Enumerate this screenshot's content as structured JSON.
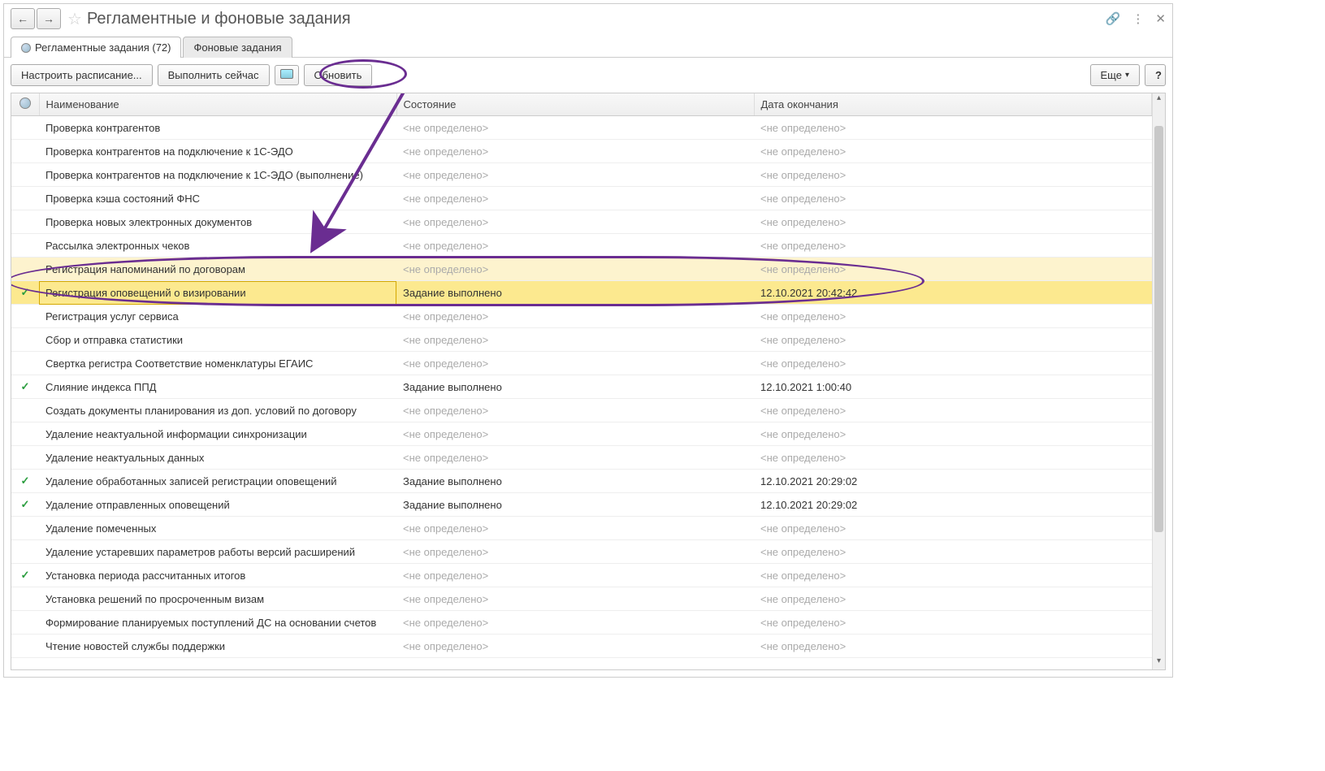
{
  "window": {
    "title": "Регламентные и фоновые задания"
  },
  "tabs": {
    "scheduled": "Регламентные задания (72)",
    "background": "Фоновые задания"
  },
  "toolbar": {
    "configure": "Настроить расписание...",
    "run_now": "Выполнить сейчас",
    "refresh": "Обновить",
    "more": "Еще",
    "help": "?"
  },
  "columns": {
    "name": "Наименование",
    "state": "Состояние",
    "end_date": "Дата окончания"
  },
  "placeholders": {
    "undefined": "<не определено>"
  },
  "states": {
    "done": "Задание выполнено"
  },
  "rows": [
    {
      "check": false,
      "name": "Проверка контрагентов",
      "state": null,
      "date": null,
      "hl": 0
    },
    {
      "check": false,
      "name": "Проверка контрагентов на подключение к 1С-ЭДО",
      "state": null,
      "date": null,
      "hl": 0
    },
    {
      "check": false,
      "name": "Проверка контрагентов на подключение к 1С-ЭДО (выполнение)",
      "state": null,
      "date": null,
      "hl": 0
    },
    {
      "check": false,
      "name": "Проверка кэша состояний ФНС",
      "state": null,
      "date": null,
      "hl": 0
    },
    {
      "check": false,
      "name": "Проверка новых электронных документов",
      "state": null,
      "date": null,
      "hl": 0
    },
    {
      "check": false,
      "name": "Рассылка электронных чеков",
      "state": null,
      "date": null,
      "hl": 0
    },
    {
      "check": false,
      "name": "Регистрация напоминаний по договорам",
      "state": null,
      "date": null,
      "hl": 1
    },
    {
      "check": true,
      "name": "Регистрация оповещений о визировании",
      "state": "done",
      "date": "12.10.2021 20:42:42",
      "hl": 2
    },
    {
      "check": false,
      "name": "Регистрация услуг сервиса",
      "state": null,
      "date": null,
      "hl": 0
    },
    {
      "check": false,
      "name": "Сбор и отправка статистики",
      "state": null,
      "date": null,
      "hl": 0
    },
    {
      "check": false,
      "name": "Свертка регистра Соответствие номенклатуры ЕГАИС",
      "state": null,
      "date": null,
      "hl": 0
    },
    {
      "check": true,
      "name": "Слияние индекса ППД",
      "state": "done",
      "date": "12.10.2021 1:00:40",
      "hl": 0
    },
    {
      "check": false,
      "name": "Создать документы планирования из доп. условий по договору",
      "state": null,
      "date": null,
      "hl": 0
    },
    {
      "check": false,
      "name": "Удаление неактуальной информации синхронизации",
      "state": null,
      "date": null,
      "hl": 0
    },
    {
      "check": false,
      "name": "Удаление неактуальных данных",
      "state": null,
      "date": null,
      "hl": 0
    },
    {
      "check": true,
      "name": "Удаление обработанных записей регистрации оповещений",
      "state": "done",
      "date": "12.10.2021 20:29:02",
      "hl": 0
    },
    {
      "check": true,
      "name": "Удаление отправленных оповещений",
      "state": "done",
      "date": "12.10.2021 20:29:02",
      "hl": 0
    },
    {
      "check": false,
      "name": "Удаление помеченных",
      "state": null,
      "date": null,
      "hl": 0
    },
    {
      "check": false,
      "name": "Удаление устаревших параметров работы версий расширений",
      "state": null,
      "date": null,
      "hl": 0
    },
    {
      "check": true,
      "name": "Установка периода рассчитанных итогов",
      "state": null,
      "date": null,
      "hl": 0
    },
    {
      "check": false,
      "name": "Установка решений по просроченным визам",
      "state": null,
      "date": null,
      "hl": 0
    },
    {
      "check": false,
      "name": "Формирование планируемых поступлений ДС на основании счетов",
      "state": null,
      "date": null,
      "hl": 0
    },
    {
      "check": false,
      "name": "Чтение новостей службы поддержки",
      "state": null,
      "date": null,
      "hl": 0
    }
  ]
}
